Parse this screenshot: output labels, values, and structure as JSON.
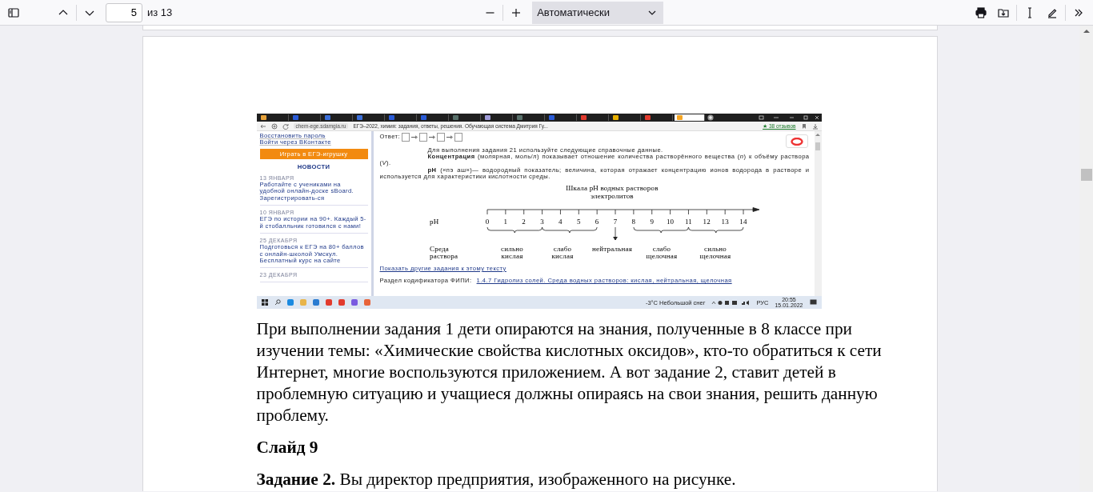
{
  "toolbar": {
    "page_number": "5",
    "page_count": "из 13",
    "zoom": "Автоматически"
  },
  "document": {
    "screenshot": {
      "tabs": [
        {
          "selected": false
        },
        {
          "selected": false
        },
        {
          "selected": false
        },
        {
          "selected": false
        },
        {
          "selected": false
        },
        {
          "selected": false
        },
        {
          "selected": false
        },
        {
          "selected": false
        },
        {
          "selected": false
        },
        {
          "selected": false
        },
        {
          "selected": false
        },
        {
          "selected": false
        },
        {
          "selected": false
        },
        {
          "selected": true
        }
      ],
      "address_bar": {
        "url": "chem-ege.sdamgia.ru",
        "page_title": "ЕГЭ–2022, химия: задания, ответы, решения. Обучающая система Дмитрия Гу...",
        "reviews": "★ 38 отзывов"
      },
      "sidebar": {
        "links": [
          "Восстановить пароль",
          "Войти через ВКонтакте"
        ],
        "game_button": "Играть в ЕГЭ-игрушку",
        "news_heading": "НОВОСТИ",
        "news": [
          {
            "date": "13 ЯНВАРЯ",
            "text": "Работайте с учениками на удобной онлайн-доске sBoard. Зарегистрировать-ся"
          },
          {
            "date": "10 ЯНВАРЯ",
            "text": "ЕГЭ по истории на 90+. Каждый 5-й стобалльник готовился с нами!"
          },
          {
            "date": "25 ДЕКАБРЯ",
            "text": "Подготовься к ЕГЭ на 80+ баллов с онлайн-школой Умскул. Бесплатный курс на сайте"
          },
          {
            "date": "23 ДЕКАБРЯ"
          }
        ]
      },
      "content": {
        "answer_label": "Ответ:",
        "intro": "Для выполнения задания 21 используйте следующие справочные данные.",
        "definitions": [
          "**Концентрация** (молярная, моль/л) показывает отношение количества растворённого вещества (*n*) к объёму раствора (*V*).",
          "**pH** («пэ аш»)— водородный показатель; величина, которая отражает концентрацию ионов водорода в растворе и используется для характеристики кислотности среды."
        ],
        "scale": {
          "title": "Шкала pH водных растворов электролитов",
          "ph_label": "pH",
          "media_label": "Среда раствора",
          "ticks": [
            "0",
            "1",
            "2",
            "3",
            "4",
            "5",
            "6",
            "7",
            "8",
            "9",
            "10",
            "11",
            "12",
            "13",
            "14"
          ],
          "zones": [
            {
              "label": "сильно кислая"
            },
            {
              "label": "слабо кислая"
            },
            {
              "label": "нейтральная"
            },
            {
              "label": "слабо щелочная"
            },
            {
              "label": "сильно щелочная"
            }
          ]
        },
        "more_link": "Показать другие задания к этому тексту",
        "codifier_label": "Раздел кодификатора ФИПИ:",
        "codifier_link": "1.4.7 Гидролиз солей. Среда водных растворов: кислая, нейтральная, щелочная"
      },
      "taskbar": {
        "weather": "-3°C Небольшой снег",
        "language": "РУС",
        "time": "20:55",
        "date": "15.01.2022"
      }
    },
    "paragraph": "При выполнении задания 1 дети опираются на знания, полученные в 8 классе при изучении темы: «Химические свойства кислотных оксидов», кто-то обратиться к сети Интернет, многие воспользуются приложением. А вот задание 2, ставит детей в проблемную ситуацию и учащиеся должны опираясь на свои знания, решить данную проблему.",
    "heading": "Слайд 9",
    "task": "**Задание 2.** Вы директор предприятия, изображенного на рисунке."
  }
}
